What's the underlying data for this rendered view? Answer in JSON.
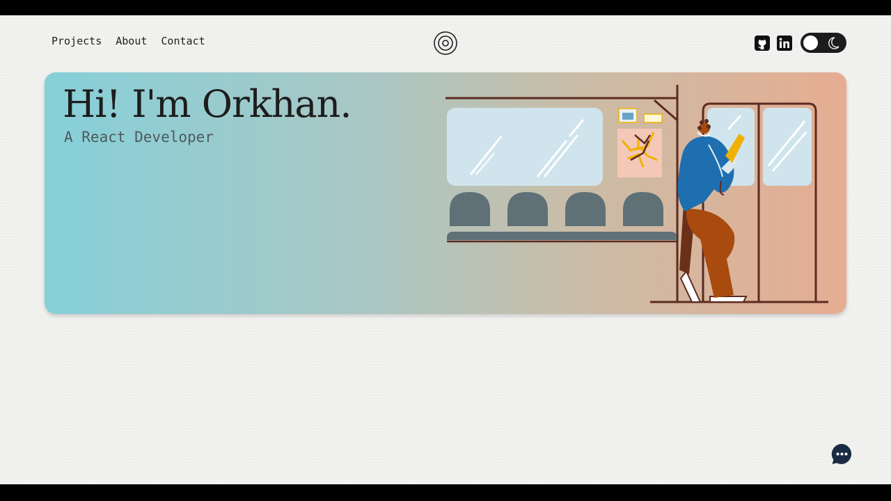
{
  "nav": {
    "items": [
      {
        "label": "Projects"
      },
      {
        "label": "About"
      },
      {
        "label": "Contact"
      }
    ]
  },
  "header": {
    "logo_icon": "concentric-circles-logo",
    "social": [
      "github-icon",
      "linkedin-icon"
    ],
    "theme_toggle": {
      "state": "light",
      "icons": [
        "sun-icon",
        "moon-icon"
      ]
    }
  },
  "hero": {
    "title": "Hi! I'm Orkhan.",
    "subtitle": "A React Developer",
    "illustration": "person-on-subway-train"
  },
  "chat": {
    "icon": "chat-bubble-icon"
  },
  "colors": {
    "gradient_start": "#86d0d9",
    "gradient_end": "#e6ad91",
    "text": "#1d1d1d",
    "toggle": "#1c1c1c",
    "chat": "#1b2b44"
  }
}
